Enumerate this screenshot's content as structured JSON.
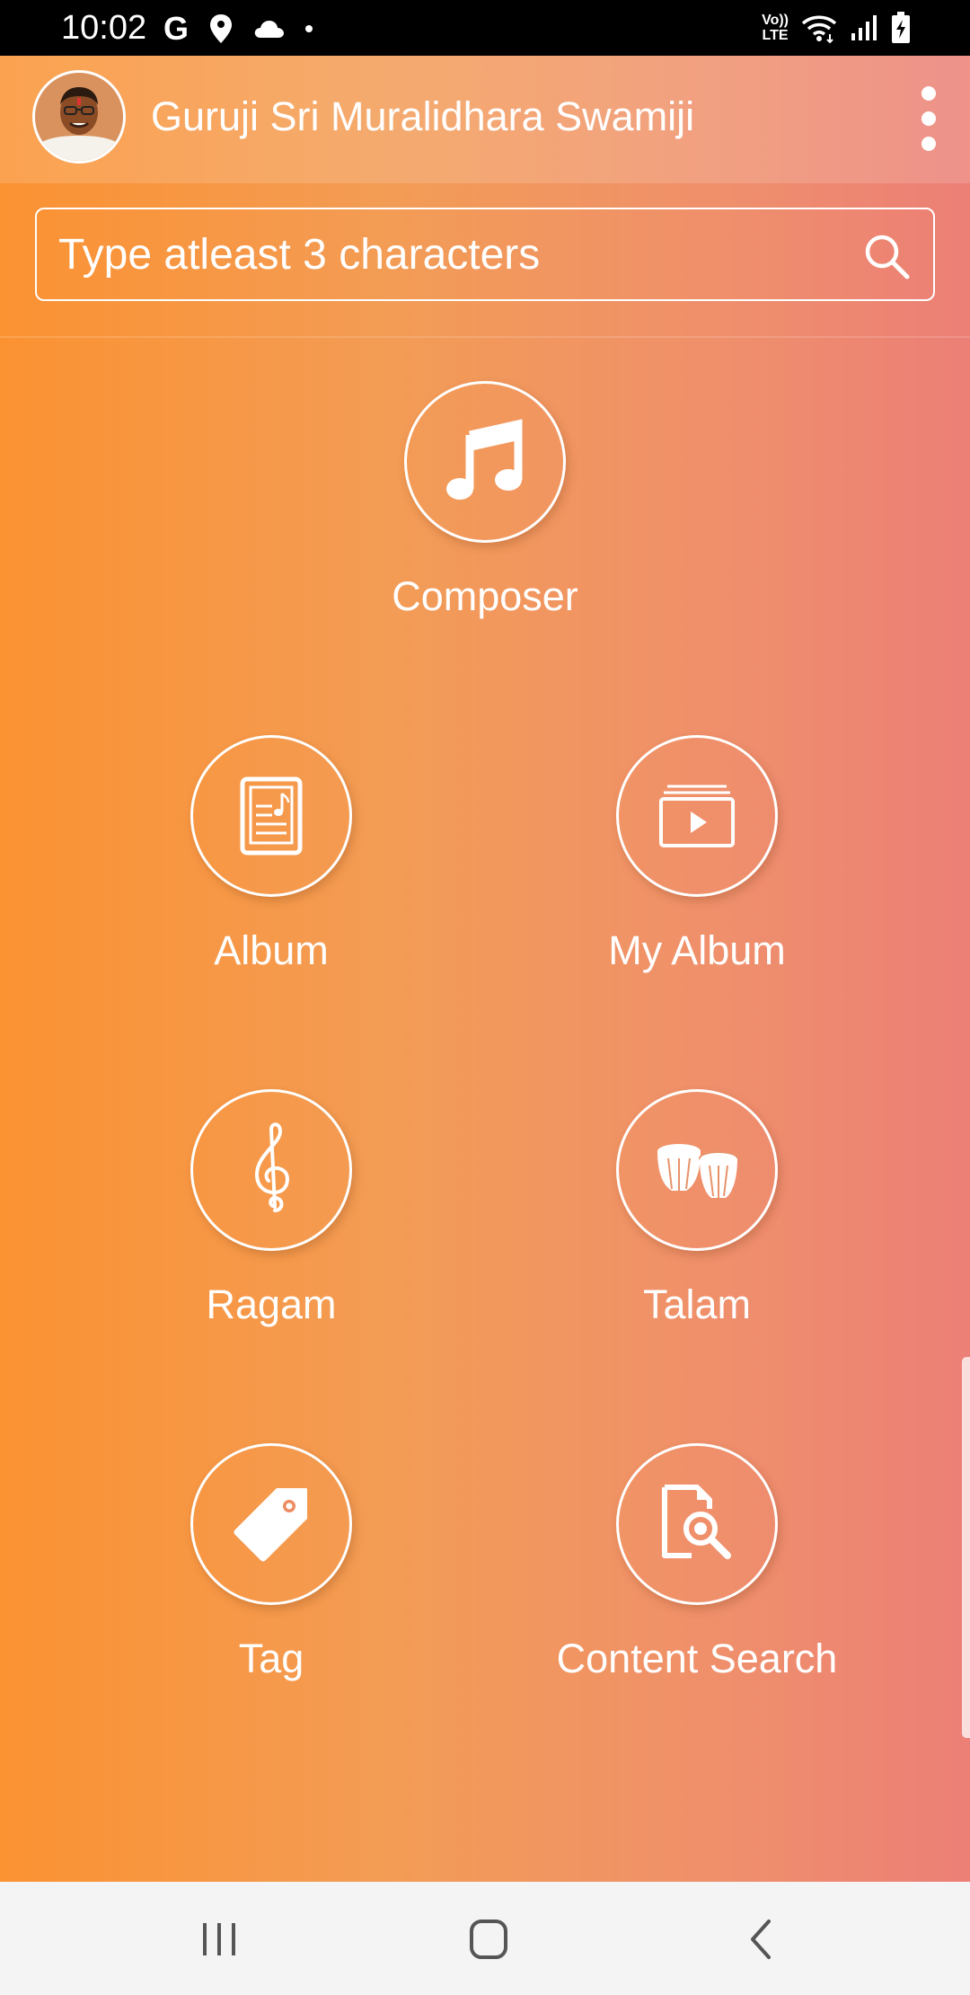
{
  "status_bar": {
    "time": "10:02",
    "left_icons": [
      "google-icon",
      "location-icon",
      "cloud-icon",
      "notification-dot-icon"
    ],
    "right_icons": [
      "volte-icon",
      "wifi-icon",
      "signal-icon",
      "battery-charging-icon"
    ],
    "volte_line1": "Vo))",
    "volte_line2": "LTE"
  },
  "header": {
    "title": "Guruji Sri Muralidhara Swamiji",
    "avatar_icon": "guru-portrait-avatar",
    "menu_icon": "more-vert-icon"
  },
  "search": {
    "placeholder": "Type atleast 3 characters",
    "value": "",
    "icon": "search-icon"
  },
  "menu": {
    "composer": {
      "label": "Composer",
      "icon": "music-note-icon"
    },
    "album": {
      "label": "Album",
      "icon": "tablet-music-icon"
    },
    "my_album": {
      "label": "My Album",
      "icon": "video-library-icon"
    },
    "ragam": {
      "label": "Ragam",
      "icon": "treble-clef-icon"
    },
    "talam": {
      "label": "Talam",
      "icon": "drums-icon"
    },
    "tag": {
      "label": "Tag",
      "icon": "tag-icon"
    },
    "content_search": {
      "label": "Content Search",
      "icon": "document-search-icon"
    }
  },
  "nav_bar": {
    "buttons": [
      "recent-apps-icon",
      "home-icon",
      "back-icon"
    ]
  },
  "colors": {
    "gradient_left": "#fb9232",
    "gradient_right": "#ec7f76",
    "text": "#ffffff",
    "nav_background": "#f4f4f4"
  }
}
